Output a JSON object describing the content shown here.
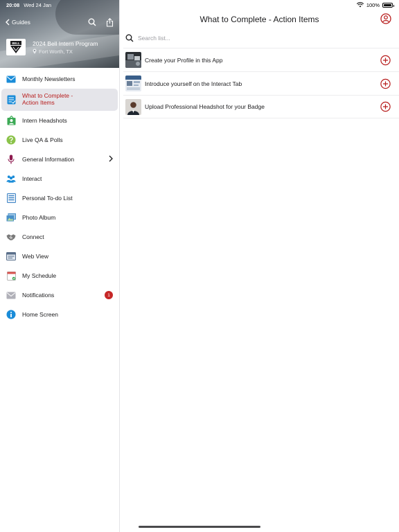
{
  "status_bar": {
    "time": "20:08",
    "date": "Wed 24 Jan",
    "battery": "100%"
  },
  "sidebar": {
    "back_label": "Guides",
    "event": {
      "name": "2024 Bell Intern Program",
      "location": "Fort Worth, TX",
      "logo_text": "BELL"
    },
    "items": [
      {
        "label": "Monthly Newsletters",
        "icon": "envelope-icon",
        "color": "#1a8cd8"
      },
      {
        "label": "What to Complete - Action Items",
        "icon": "checklist-icon",
        "color": "#1a8cd8",
        "active": true
      },
      {
        "label": "Intern Headshots",
        "icon": "headshot-icon",
        "color": "#3caa55"
      },
      {
        "label": "Live QA & Polls",
        "icon": "question-icon",
        "color": "#8bc34a"
      },
      {
        "label": "General Information",
        "icon": "microphone-icon",
        "color": "#8e1b4f",
        "chevron": true
      },
      {
        "label": "Interact",
        "icon": "people-icon",
        "color": "#1a8cd8"
      },
      {
        "label": "Personal To-do List",
        "icon": "todo-list-icon",
        "color": "#3b82c4"
      },
      {
        "label": "Photo Album",
        "icon": "photo-icon",
        "color": "#4a90c8"
      },
      {
        "label": "Connect",
        "icon": "handshake-icon",
        "color": "#7a7a7a"
      },
      {
        "label": "Web View",
        "icon": "browser-icon",
        "color": "#5a6f8a"
      },
      {
        "label": "My Schedule",
        "icon": "calendar-icon",
        "color": "#d9534f"
      },
      {
        "label": "Notifications",
        "icon": "mail-icon",
        "color": "#b0b0b8",
        "badge": "1"
      },
      {
        "label": "Home Screen",
        "icon": "info-icon",
        "color": "#1a8cd8"
      }
    ]
  },
  "main": {
    "title": "What to Complete - Action Items",
    "search_placeholder": "Search list...",
    "items": [
      {
        "label": "Create your Profile in this App",
        "thumb": "app-screenshot-thumb"
      },
      {
        "label": "Introduce yourself on the Interact Tab",
        "thumb": "interact-screenshot-thumb"
      },
      {
        "label": "Upload Professional Headshot for your Badge",
        "thumb": "headshot-photo-thumb"
      }
    ]
  },
  "colors": {
    "accent": "#b71c1c",
    "active_bg": "#e5e5ea"
  }
}
